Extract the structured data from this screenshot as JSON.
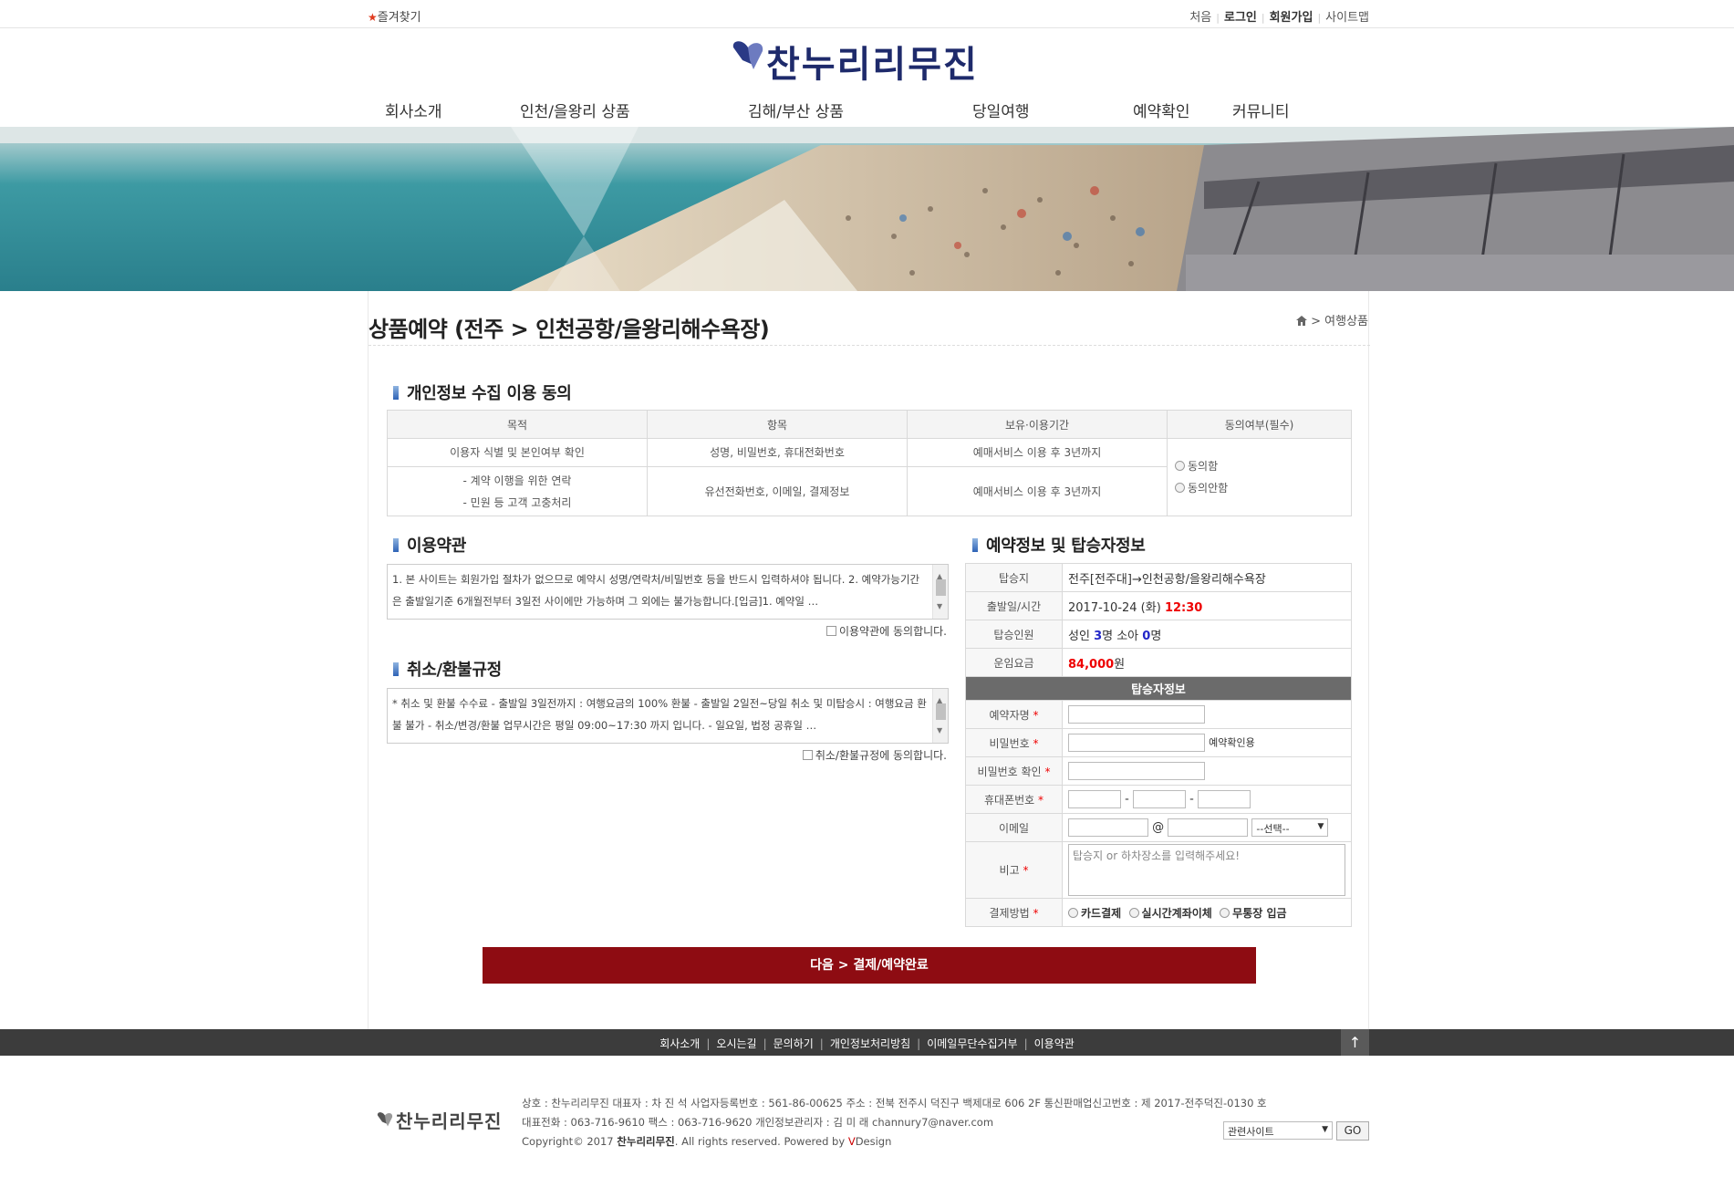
{
  "topbar": {
    "favorite": "즐겨찾기",
    "links": [
      "처음",
      "로그인",
      "회원가입",
      "사이트맵"
    ]
  },
  "logo": {
    "text": "찬누리리무진"
  },
  "nav": [
    "회사소개",
    "인천/을왕리 상품",
    "김해/부산 상품",
    "당일여행",
    "예약확인",
    "커뮤니티"
  ],
  "page": {
    "title": "상품예약 (전주 > 인천공항/을왕리해수욕장)",
    "breadcrumb": "> 여행상품"
  },
  "privacy": {
    "title": "개인정보 수집 이용 동의",
    "headers": [
      "목적",
      "항목",
      "보유·이용기간",
      "동의여부(필수)"
    ],
    "rows": [
      {
        "purpose": "이용자 식별 및 본인여부 확인",
        "items": "성명, 비밀번호, 휴대전화번호",
        "period": "예매서비스 이용 후 3년까지"
      },
      {
        "purpose1": "- 계약 이행을 위한 연락",
        "purpose2": "- 민원 등 고객 고충처리",
        "items": "유선전화번호, 이메일, 결제정보",
        "period": "예매서비스 이용 후 3년까지"
      }
    ],
    "agree": "동의함",
    "disagree": "동의안함"
  },
  "terms": {
    "title": "이용약관",
    "text": "1. 본 사이트는 회원가입 절차가 없으므로 예약시 성명/연락처/비밀번호 등을 반드시 입력하셔야 됩니다. 2. 예약가능기간은 출발일기준 6개월전부터 3일전 사이에만 가능하며 그 외에는 불가능합니다.[입금]1. 예약일 …",
    "agree_label": "이용약관에 동의합니다."
  },
  "refund": {
    "title": "취소/환불규정",
    "text": "* 취소 및 환불 수수료  - 출발일 3일전까지 : 여행요금의 100% 환불  - 출발일 2일전~당일 취소 및 미탑승시 : 여행요금 환불 불가 - 취소/변경/환불 업무시간은 평일 09:00~17:30 까지 입니다. - 일요일, 법정 공휴일 …",
    "agree_label": "취소/환불규정에 동의합니다."
  },
  "reservation": {
    "title": "예약정보 및 탑승자정보",
    "rows": {
      "boarding_label": "탑승지",
      "boarding_value": "전주[전주대]→인천공항/을왕리해수욕장",
      "departure_label": "출발일/시간",
      "departure_date": "2017-10-24 (화)",
      "departure_time": "12:30",
      "passengers_label": "탑승인원",
      "adult_label": "성인",
      "adult_count": "3",
      "adult_unit": "명",
      "child_label": "소아",
      "child_count": "0",
      "child_unit": "명",
      "fare_label": "운임요금",
      "fare_value": "84,000",
      "fare_unit": "원"
    },
    "passenger_header": "탑승자정보",
    "fields": {
      "name": "예약자명",
      "password": "비밀번호",
      "password_hint": "예약확인용",
      "password_confirm": "비밀번호 확인",
      "phone": "휴대폰번호",
      "phone_sep": "-",
      "email": "이메일",
      "email_at": "@",
      "email_select": "--선택--",
      "note": "비고",
      "note_placeholder": "탑승지 or 하차장소를 입력해주세요!",
      "payment": "결제방법",
      "pay_card": "카드결제",
      "pay_transfer": "실시간계좌이체",
      "pay_deposit": "무통장 입금",
      "required_mark": "*"
    }
  },
  "next_button": "다음 > 결제/예약완료",
  "footer": {
    "links": [
      "회사소개",
      "오시는길",
      "문의하기",
      "개인정보처리방침",
      "이메일무단수집거부",
      "이용약관"
    ],
    "top": "↑",
    "logo": "찬누리리무진",
    "line1": "상호 : 찬누리리무진 대표자 : 차 진 석 사업자등록번호 : 561-86-00625 주소 : 전북 전주시 덕진구 백제대로 606 2F 통신판매업신고번호 : 제 2017-전주덕진-0130 호",
    "line2": "대표전화 : 063-716-9610 팩스 : 063-716-9620 개인정보관리자 : 김 미 래 channury7@naver.com",
    "copy_pre": "Copyright© 2017",
    "copy_brand": "찬누리리무진",
    "copy_mid": ". All rights reserved. Powered by",
    "copy_v": "V",
    "copy_design": "Design",
    "related_select": "관련사이트",
    "go": "GO"
  },
  "colors": {
    "accent_red": "#8e0c12",
    "logo_navy": "#1e2a6b",
    "footer_bar": "#3c3c3c",
    "price_red": "#ee0000",
    "count_blue": "#2226c8"
  }
}
